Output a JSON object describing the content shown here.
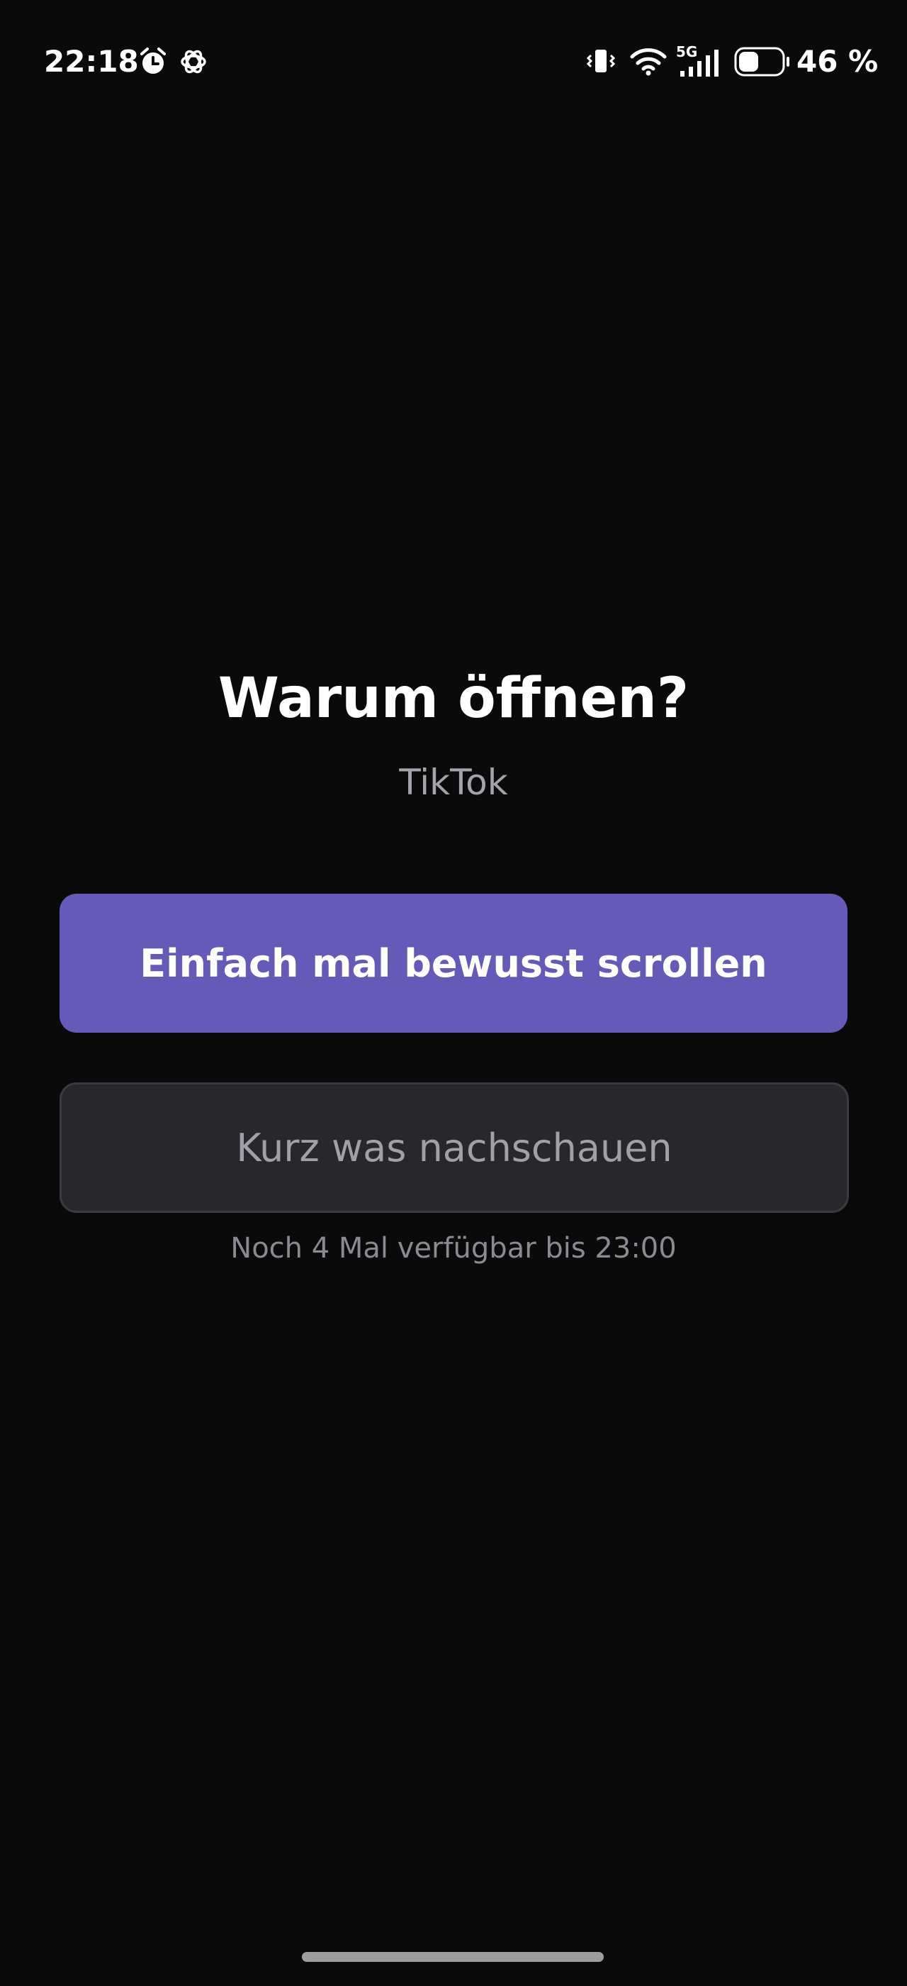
{
  "status_bar": {
    "time": "22:18",
    "battery_percent": "46 %",
    "battery_level": 0.46,
    "network": "5G",
    "icons": [
      "alarm-icon",
      "chatgpt-icon",
      "vibrate-icon",
      "wifi-icon",
      "signal-5g-icon",
      "battery-icon"
    ]
  },
  "prompt": {
    "title": "Warum öffnen?",
    "app_name": "TikTok"
  },
  "options": {
    "primary_label": "Einfach mal bewusst scrollen",
    "secondary_label": "Kurz was nachschauen",
    "availability_note": "Noch 4 Mal verfügbar bis 23:00"
  },
  "colors": {
    "background": "#0a0a0b",
    "primary": "#665ab8",
    "secondary": "#27272c"
  }
}
